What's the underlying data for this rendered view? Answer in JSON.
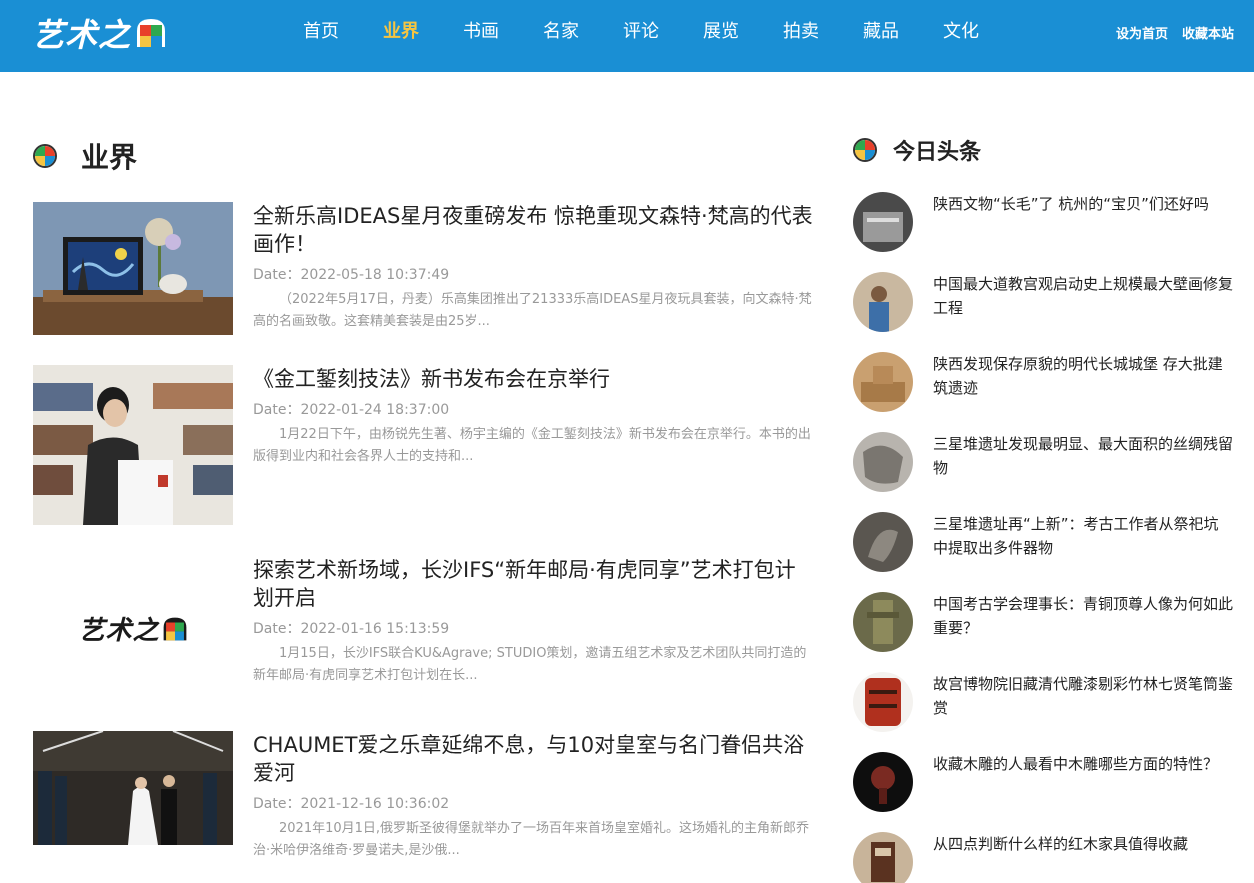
{
  "header": {
    "logo_text": "艺术之",
    "nav": [
      "首页",
      "业界",
      "书画",
      "名家",
      "评论",
      "展览",
      "拍卖",
      "藏品",
      "文化"
    ],
    "active_index": 1,
    "links": [
      "设为首页",
      "收藏本站"
    ]
  },
  "main": {
    "section_title": "业界",
    "articles": [
      {
        "title": "全新乐高IDEAS星月夜重磅发布 惊艳重现文森特·梵高的代表画作！",
        "date": "Date：2022-05-18 10:37:49",
        "summary": "（2022年5月17日，丹麦）乐高集团推出了21333乐高IDEAS星月夜玩具套装，向文森特·梵高的名画致敬。这套精美套装是由25岁..."
      },
      {
        "title": "《金工錾刻技法》新书发布会在京举行",
        "date": "Date：2022-01-24 18:37:00",
        "summary": "1月22日下午，由杨锐先生著、杨宇主编的《金工錾刻技法》新书发布会在京举行。本书的出版得到业内和社会各界人士的支持和..."
      },
      {
        "title": "探索艺术新场域，长沙IFS“新年邮局·有虎同享”艺术打包计划开启",
        "date": "Date：2022-01-16 15:13:59",
        "summary": "1月15日，长沙IFS联合KU&Agrave; STUDIO策划，邀请五组艺术家及艺术团队共同打造的新年邮局·有虎同享艺术打包计划在长...",
        "thumb_logo_text": "艺术之"
      },
      {
        "title": "CHAUMET爱之乐章延绵不息，与10对皇室与名门眷侣共浴爱河",
        "date": "Date：2021-12-16 10:36:02",
        "summary": "2021年10月1日,俄罗斯圣彼得堡就举办了一场百年来首场皇室婚礼。这场婚礼的主角新郎乔治·米哈伊洛维奇·罗曼诺夫,是沙俄..."
      }
    ]
  },
  "sidebar": {
    "section_title": "今日头条",
    "items": [
      "陕西文物“长毛”了 杭州的“宝贝”们还好吗",
      "中国最大道教宫观启动史上规模最大壁画修复工程",
      "陕西发现保存原貌的明代长城城堡 存大批建筑遗迹",
      "三星堆遗址发现最明显、最大面积的丝绸残留物",
      "三星堆遗址再“上新”：考古工作者从祭祀坑中提取出多件器物",
      "中国考古学会理事长：青铜顶尊人像为何如此重要？",
      "故宫博物院旧藏清代雕漆剔彩竹林七贤笔筒鉴赏",
      "收藏木雕的人最看中木雕哪些方面的特性？",
      "从四点判断什么样的红木家具值得收藏"
    ]
  },
  "colors": {
    "header_bg": "#1a8fd4",
    "nav_active": "#f5c542",
    "ball": [
      "#2fa84f",
      "#e8402a",
      "#f5c542",
      "#1a8fd4"
    ]
  }
}
